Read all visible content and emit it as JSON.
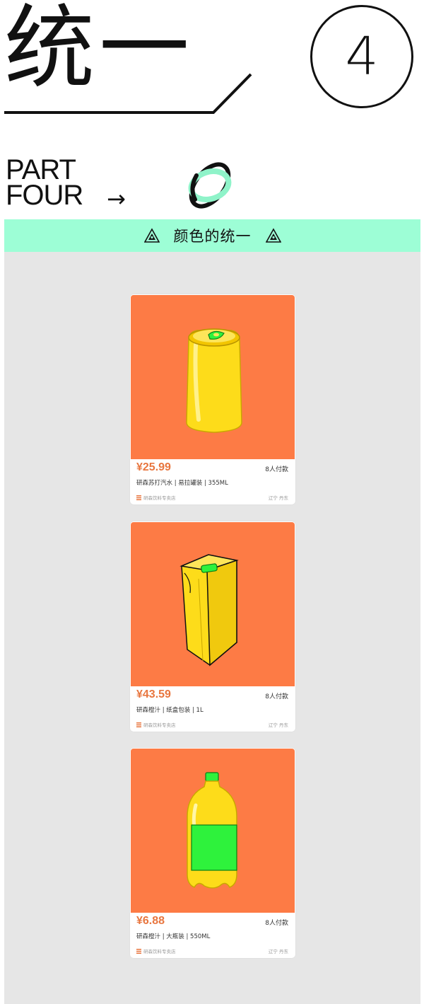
{
  "header": {
    "title": "统一",
    "number": "4",
    "part_label_line1": "PART",
    "part_label_line2": "FOUR",
    "arrow": "→"
  },
  "banner": {
    "title": "颜色的统一",
    "icon": "warning-triangle-icon",
    "color": "#9dfed6"
  },
  "colors": {
    "panel_bg": "#e6e6e6",
    "card_image_bg": "#fd7b45",
    "price_color": "#e8763f",
    "product_yellow": "#fddc1a",
    "accent_green": "#2ef23c"
  },
  "products": [
    {
      "price": "¥25.99",
      "paid": "8人付款",
      "name": "研森苏打汽水 | 易拉罐装 | 355ML",
      "shop": "研森饮料专卖店",
      "location": "辽宁 丹东",
      "icon": "soda-can-icon"
    },
    {
      "price": "¥43.59",
      "paid": "8人付款",
      "name": "研森橙汁 | 纸盒包装 | 1L",
      "shop": "研森饮料专卖店",
      "location": "辽宁 丹东",
      "icon": "juice-carton-icon"
    },
    {
      "price": "¥6.88",
      "paid": "8人付款",
      "name": "研森橙汁 | 大瓶装 | 550ML",
      "shop": "研森饮料专卖店",
      "location": "辽宁 丹东",
      "icon": "juice-bottle-icon"
    }
  ]
}
